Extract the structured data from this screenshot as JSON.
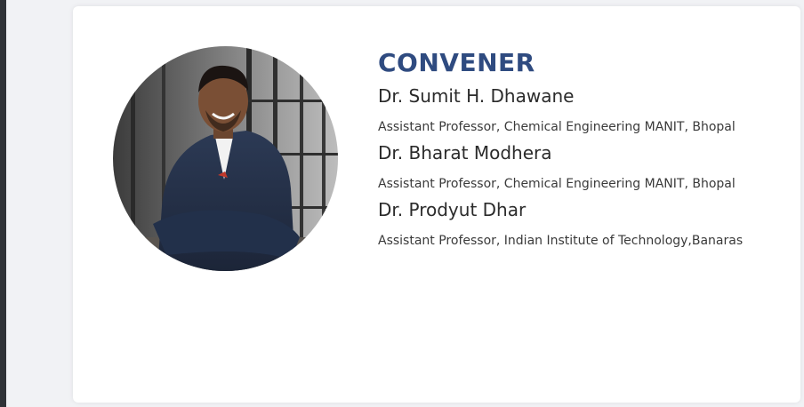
{
  "section": {
    "heading": "CONVENER",
    "photo_alt": "convener-photo"
  },
  "members": [
    {
      "name": "Dr. Sumit H. Dhawane",
      "title": "Assistant Professor, Chemical Engineering MANIT, Bhopal"
    },
    {
      "name": "Dr. Bharat Modhera",
      "title": "Assistant Professor, Chemical Engineering MANIT, Bhopal"
    },
    {
      "name": "Dr. Prodyut Dhar",
      "title": "Assistant Professor, Indian Institute of Technology,Banaras"
    }
  ],
  "colors": {
    "heading": "#2f4b80",
    "card": "#ffffff",
    "page_bg": "#f1f2f5",
    "left_strip": "#2f3237"
  }
}
